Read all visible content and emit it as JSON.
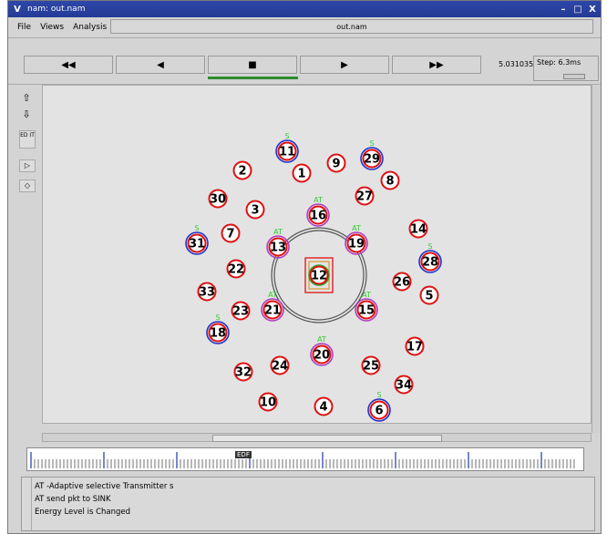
{
  "window": {
    "title": "nam: out.nam"
  },
  "menu": {
    "items": [
      "File",
      "Views",
      "Analysis"
    ],
    "filename": "out.nam"
  },
  "toolbar": {
    "buttons": [
      "◀◀",
      "◀",
      "■",
      "▶",
      "▶▶"
    ],
    "time": "5.031035",
    "step_label": "Step: 6.3ms"
  },
  "sidetools": {
    "edit_label": "ED IT"
  },
  "timeline": {
    "marker": "EDF"
  },
  "annotations": [
    "AT -Adaptive selective Transmitter s",
    "AT send pkt to SINK",
    "Energy Level is Changed"
  ],
  "nodes": [
    {
      "id": "1",
      "tag": ""
    },
    {
      "id": "2",
      "tag": ""
    },
    {
      "id": "3",
      "tag": ""
    },
    {
      "id": "4",
      "tag": ""
    },
    {
      "id": "5",
      "tag": ""
    },
    {
      "id": "6",
      "tag": "S"
    },
    {
      "id": "7",
      "tag": ""
    },
    {
      "id": "8",
      "tag": ""
    },
    {
      "id": "9",
      "tag": ""
    },
    {
      "id": "10",
      "tag": ""
    },
    {
      "id": "11",
      "tag": "S"
    },
    {
      "id": "12",
      "tag": ""
    },
    {
      "id": "13",
      "tag": "AT"
    },
    {
      "id": "14",
      "tag": ""
    },
    {
      "id": "15",
      "tag": "AT"
    },
    {
      "id": "16",
      "tag": "AT"
    },
    {
      "id": "17",
      "tag": ""
    },
    {
      "id": "18",
      "tag": "S"
    },
    {
      "id": "19",
      "tag": "AT"
    },
    {
      "id": "20",
      "tag": "AT"
    },
    {
      "id": "21",
      "tag": "AT"
    },
    {
      "id": "22",
      "tag": ""
    },
    {
      "id": "23",
      "tag": ""
    },
    {
      "id": "24",
      "tag": ""
    },
    {
      "id": "25",
      "tag": ""
    },
    {
      "id": "26",
      "tag": ""
    },
    {
      "id": "27",
      "tag": ""
    },
    {
      "id": "28",
      "tag": "S"
    },
    {
      "id": "29",
      "tag": "S"
    },
    {
      "id": "30",
      "tag": ""
    },
    {
      "id": "31",
      "tag": "S"
    },
    {
      "id": "32",
      "tag": ""
    },
    {
      "id": "33",
      "tag": ""
    },
    {
      "id": "34",
      "tag": ""
    }
  ],
  "colors": {
    "node_ring": "#e01010",
    "sink_ring": "#2233cc",
    "at_ring": "#b040c0",
    "tag_text": "#36c936",
    "title_bar": "#2e46a8"
  }
}
